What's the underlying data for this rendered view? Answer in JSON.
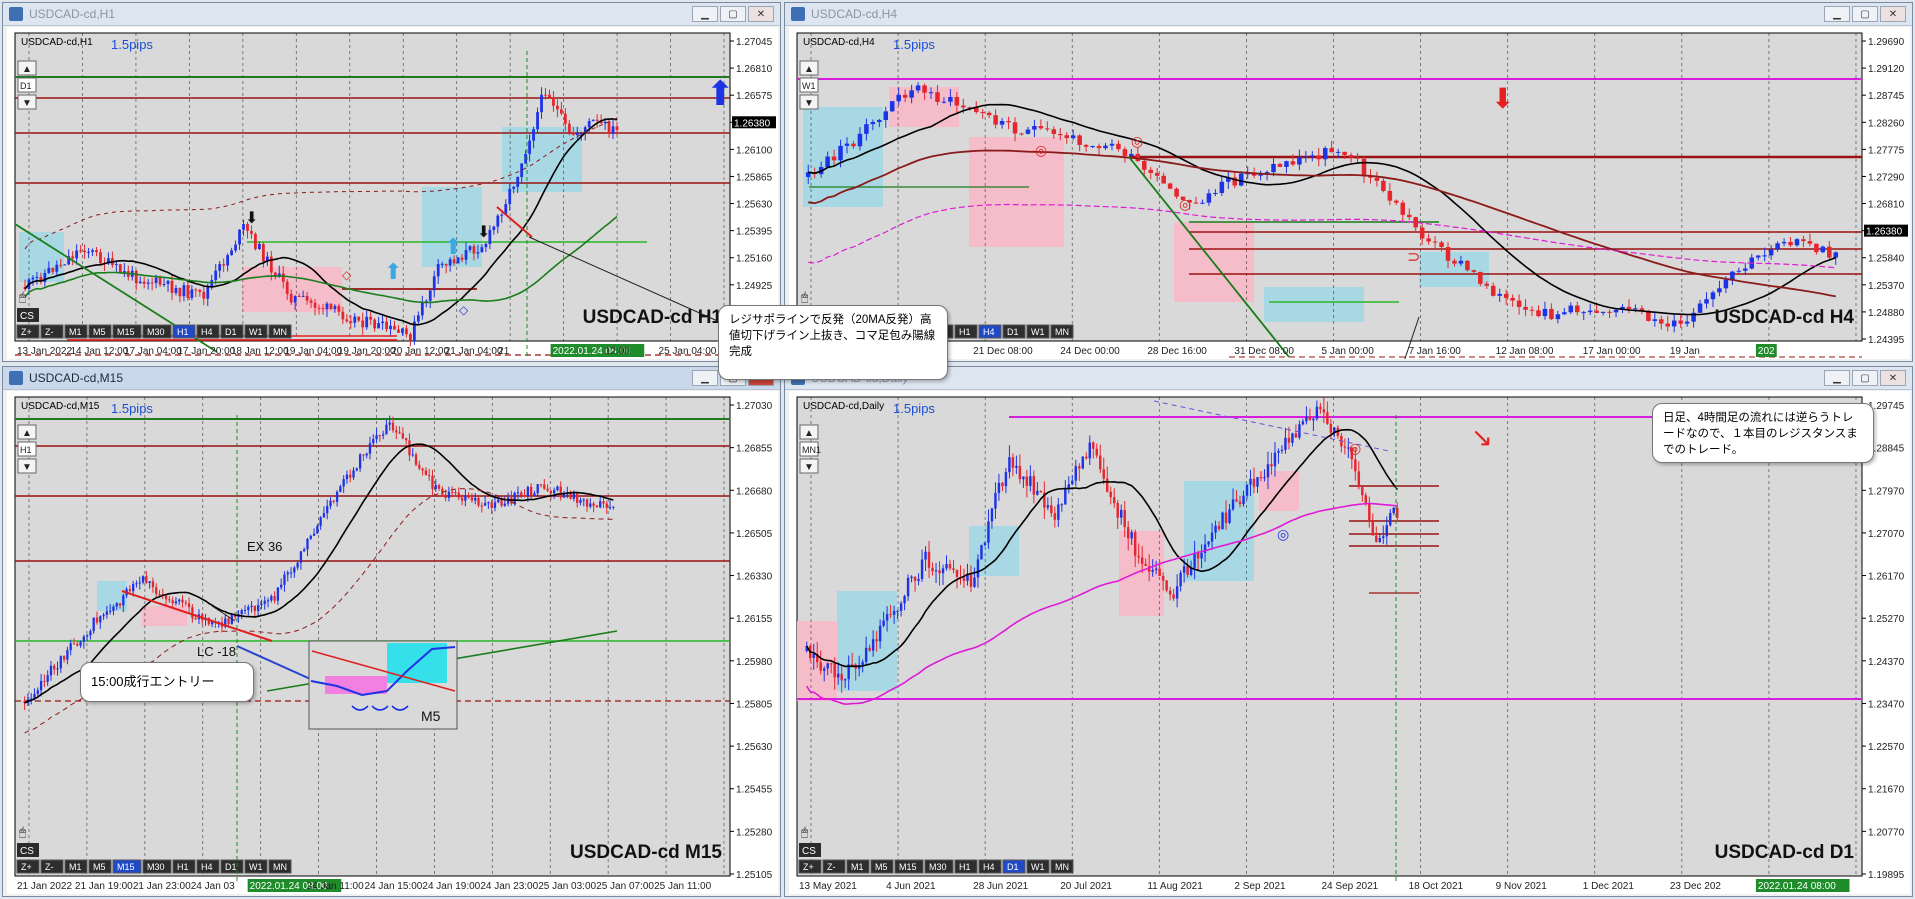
{
  "colors": {
    "bull": "#1d33e6",
    "bear": "#e6262e",
    "ma20": "#000000",
    "ma_long": "#8b1a1a",
    "ma_magenta": "#e01ad6",
    "ma_green": "#1b7d1b",
    "zone_blue": "#a5d8e4",
    "zone_pink": "#f6bcc8",
    "res_line": "#9b1212",
    "sup_green": "#28b828",
    "top_line": "#1f7a1f",
    "mag_line": "#d61ee0"
  },
  "windows": [
    {
      "id": "h1",
      "title": "USDCAD-cd,H1",
      "symbol": "USDCAD-cd,H1",
      "pips": "1.5pips",
      "watermark": "USDCAD-cd H1",
      "tf_box": "D1",
      "prices": [
        "1.27045",
        "1.26810",
        "1.26575",
        "1.26380",
        "1.26100",
        "1.25865",
        "1.25630",
        "1.25395",
        "1.25160",
        "1.24925",
        "1.24690",
        "1.24455"
      ],
      "current_price": "1.26380",
      "times": [
        "13 Jan 2022",
        "14 Jan 12:00",
        "17 Jan 04:00",
        "17 Jan 20:00",
        "18 Jan 12:00",
        "19 Jan 04:00",
        "19 Jan 20:00",
        "20 Jan 12:00",
        "21 Jan 04:00",
        "21",
        "2022.01.24 08:00",
        "12:00",
        "25 Jan 04:00"
      ],
      "time_highlight": "2022.01.24 08:00"
    },
    {
      "id": "h4",
      "title": "USDCAD-cd,H4",
      "symbol": "USDCAD-cd,H4",
      "pips": "1.5pips",
      "watermark": "USDCAD-cd H4",
      "tf_box": "W1",
      "prices": [
        "1.29690",
        "1.29120",
        "1.28745",
        "1.28260",
        "1.27775",
        "1.27290",
        "1.26810",
        "1.26380",
        "1.25840",
        "1.25370",
        "1.24880",
        "1.24395"
      ],
      "current_price": "1.26380",
      "times": [
        "14 Dec 2021",
        "16 Dec 16:00",
        "21 Dec 08:00",
        "24 Dec 00:00",
        "28 Dec 16:00",
        "31 Dec 08:00",
        "5 Jan 00:00",
        "7 Jan 16:00",
        "12 Jan 08:00",
        "17 Jan 00:00",
        "19 Jan",
        "202"
      ],
      "time_highlight": "202"
    },
    {
      "id": "m15",
      "title": "USDCAD-cd,M15",
      "symbol": "USDCAD-cd,M15",
      "pips": "1.5pips",
      "watermark": "USDCAD-cd M15",
      "tf_box": "H1",
      "prices": [
        "1.27030",
        "1.26855",
        "1.26680",
        "1.26505",
        "1.26330",
        "1.26155",
        "1.25980",
        "1.25805",
        "1.25630",
        "1.25455",
        "1.25280",
        "1.25105"
      ],
      "current_price": "1.26380",
      "times": [
        "21 Jan 2022",
        "21 Jan 19:00",
        "21 Jan 23:00",
        "24 Jan 03",
        "2022.01.24 08:00",
        "24 Jan 11:00",
        "24 Jan 15:00",
        "24 Jan 19:00",
        "24 Jan 23:00",
        "25 Jan 03:00",
        "25 Jan 07:00",
        "25 Jan 11:00"
      ],
      "time_highlight": "2022.01.24 08:00"
    },
    {
      "id": "d1",
      "title": "USDCAD-cd,Daily",
      "symbol": "USDCAD-cd,Daily",
      "pips": "1.5pips",
      "watermark": "USDCAD-cd D1",
      "tf_box": "MN1",
      "prices": [
        "1.29745",
        "1.28845",
        "1.27970",
        "1.27070",
        "1.26170",
        "1.25270",
        "1.24370",
        "1.23470",
        "1.22570",
        "1.21670",
        "1.20770",
        "1.19895"
      ],
      "current_price": "1.26380",
      "times": [
        "13 May 2021",
        "4 Jun 2021",
        "28 Jun 2021",
        "20 Jul 2021",
        "11 Aug 2021",
        "2 Sep 2021",
        "24 Sep 2021",
        "18 Oct 2021",
        "9 Nov 2021",
        "1 Dec 2021",
        "23 Dec 202",
        "2022.01.24 08:00"
      ],
      "time_highlight": "2022.01.24 08:00"
    }
  ],
  "toolbar": [
    "Z+",
    "Z-",
    "M1",
    "M5",
    "M15",
    "M30",
    "H1",
    "H4",
    "D1",
    "W1",
    "MN"
  ],
  "toolbar_active": {
    "h1": "H1",
    "h4": "H4",
    "m15": "M15",
    "d1": "D1"
  },
  "cs_label": "CS",
  "annotations": {
    "h1_callout": "レジサポラインで反発（20MA反発）高値切下げライン上抜き、コマ足包み陽線完成",
    "h4_callout": "日足、4時間足の流れには逆らうトレードなので、１本目のレジスタンスまでのトレード。",
    "m15_callout": "15:00成行エントリー",
    "ex_label": "EX  36",
    "lc_label": "LC -18",
    "m5_label": "M5"
  }
}
